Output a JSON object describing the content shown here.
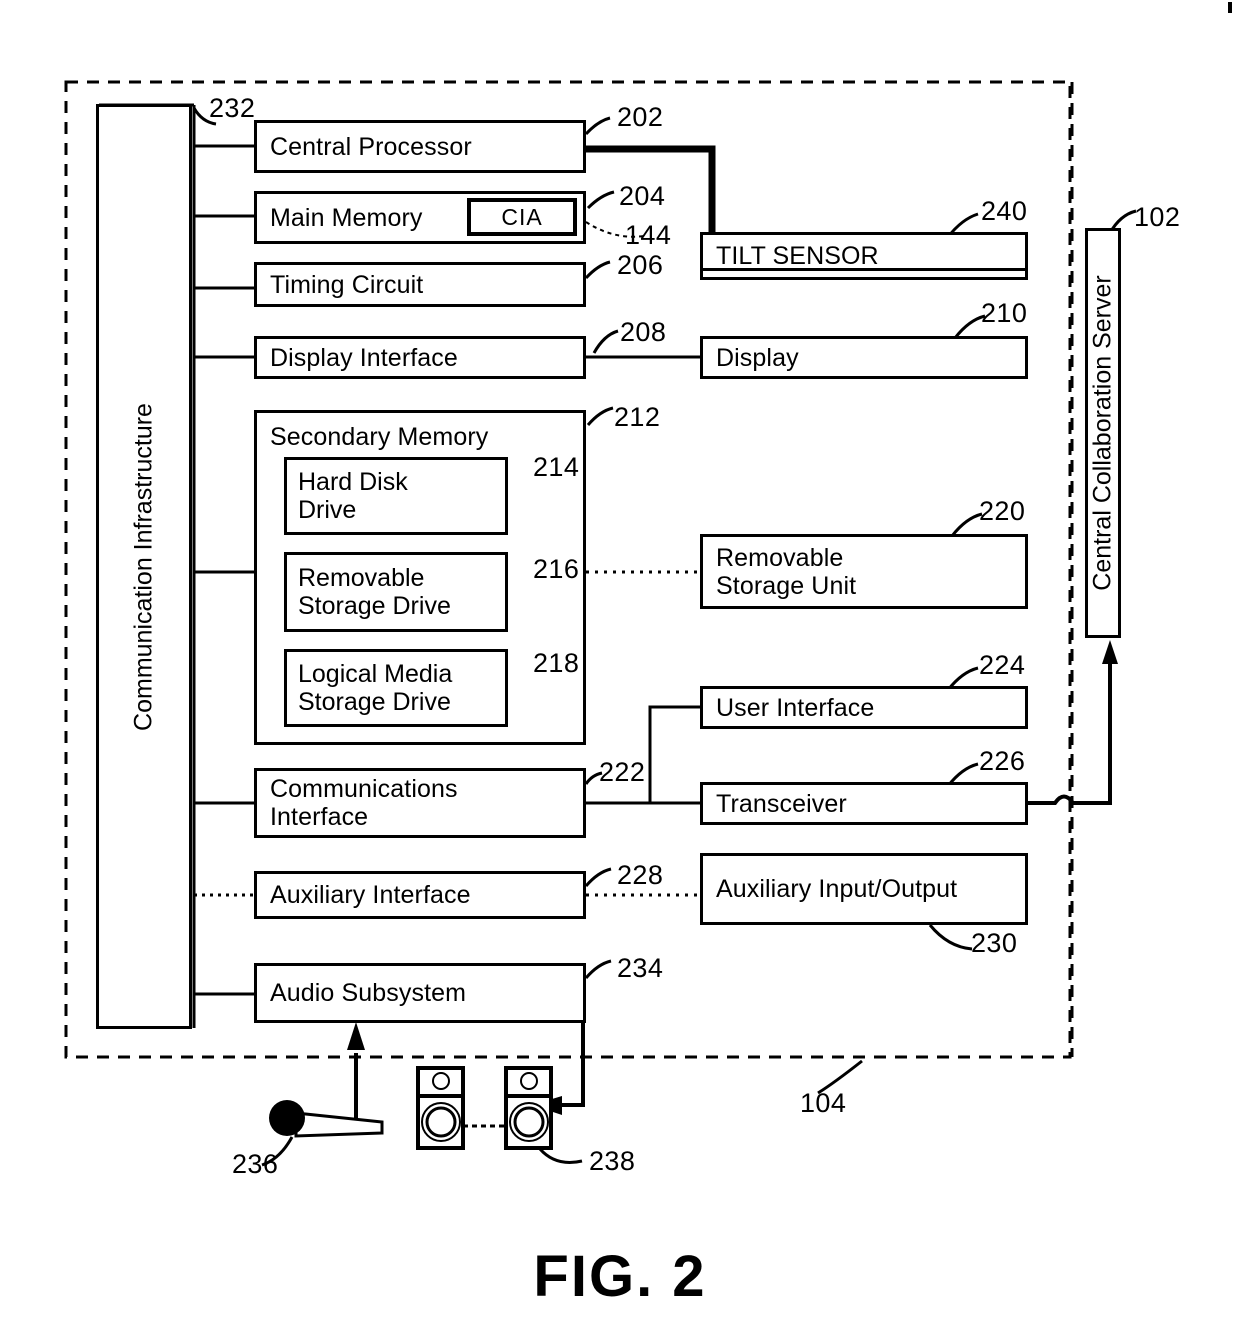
{
  "figure": {
    "caption": "FIG. 2",
    "device_ref": "104",
    "bus_ref": "232",
    "bus_label": "Communication Infrastructure",
    "server_label": "Central Collaboration Server",
    "server_ref": "102"
  },
  "blocks": {
    "central_processor": {
      "label": "Central Processor",
      "ref": "202"
    },
    "main_memory": {
      "label": "Main Memory",
      "ref": "204",
      "inner_label": "CIA",
      "inner_ref": "144"
    },
    "timing_circuit": {
      "label": "Timing Circuit",
      "ref": "206"
    },
    "display_interface": {
      "label": "Display Interface",
      "ref": "208"
    },
    "display": {
      "label": "Display",
      "ref": "210"
    },
    "tilt_sensor": {
      "label": "TILT SENSOR",
      "ref": "240"
    },
    "secondary_memory": {
      "label": "Secondary Memory",
      "ref": "212"
    },
    "hard_disk_drive": {
      "label": "Hard Disk\nDrive",
      "ref": "214"
    },
    "removable_storage_drive": {
      "label": "Removable\nStorage Drive",
      "ref": "216"
    },
    "logical_media_storage_drive": {
      "label": "Logical Media\nStorage Drive",
      "ref": "218"
    },
    "removable_storage_unit": {
      "label": "Removable\nStorage Unit",
      "ref": "220"
    },
    "communications_interface": {
      "label": "Communications\nInterface",
      "ref": "222"
    },
    "user_interface": {
      "label": "User Interface",
      "ref": "224"
    },
    "transceiver": {
      "label": "Transceiver",
      "ref": "226"
    },
    "auxiliary_interface": {
      "label": "Auxiliary Interface",
      "ref": "228"
    },
    "auxiliary_input_output": {
      "label": "Auxiliary Input/Output",
      "ref": "230"
    },
    "audio_subsystem": {
      "label": "Audio Subsystem",
      "ref": "234"
    },
    "microphone": {
      "ref": "236"
    },
    "speakers": {
      "ref": "238"
    }
  },
  "colors": {
    "line": "#000000",
    "background": "#ffffff"
  }
}
